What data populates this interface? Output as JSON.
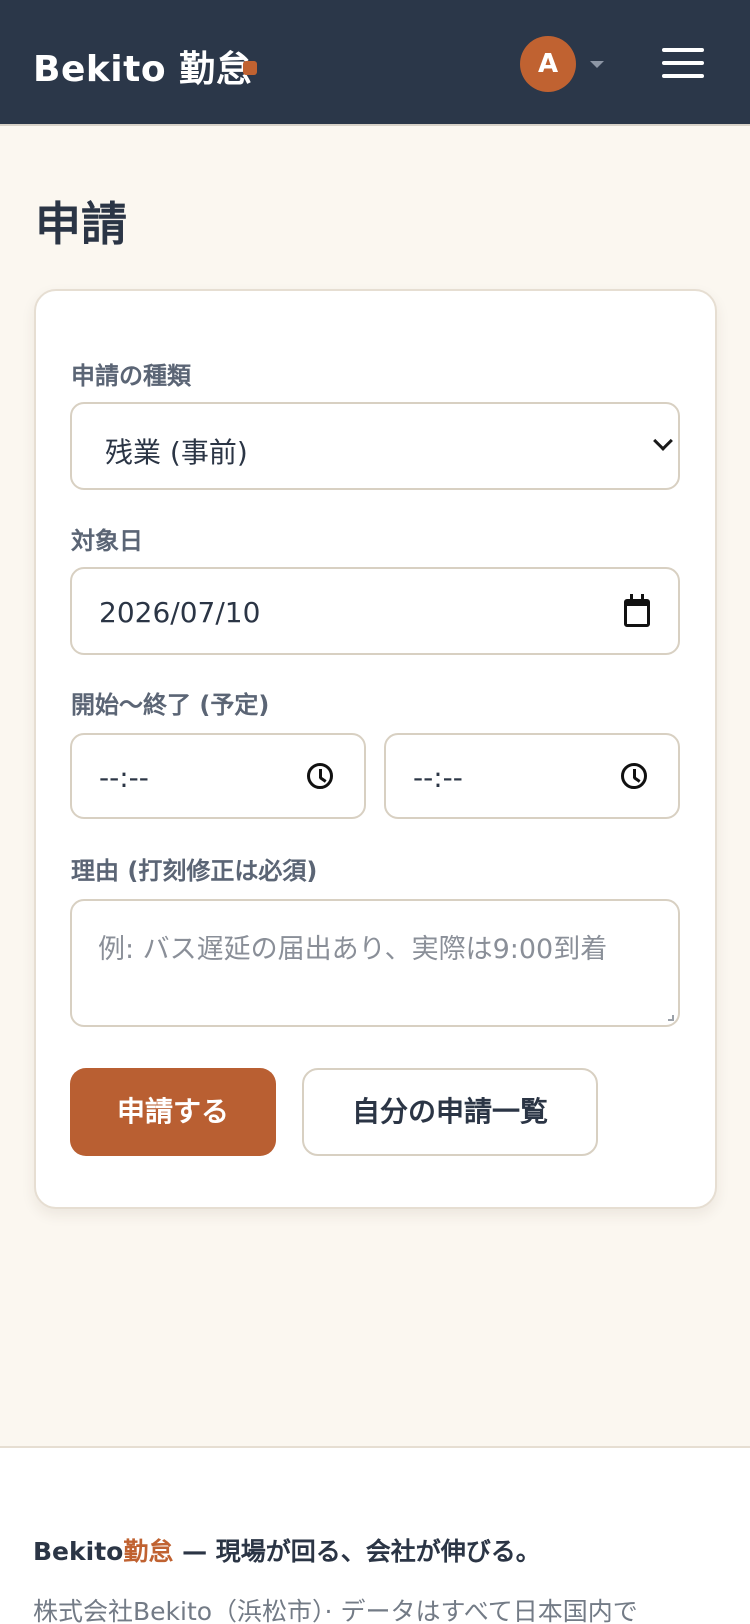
{
  "header": {
    "brand": "Bekito 勤怠",
    "avatar_initial": "A",
    "menu_icon": "hamburger-menu-icon"
  },
  "page": {
    "title": "申請"
  },
  "form": {
    "type_label": "申請の種類",
    "type_value": "残業 (事前)",
    "date_label": "対象日",
    "date_value": "2026/07/10",
    "time_label": "開始〜終了 (予定)",
    "start_time_value": "--:--",
    "end_time_value": "--:--",
    "reason_label": "理由 (打刻修正は必須)",
    "reason_placeholder": "例: バス遅延の届出あり、実際は9:00到着",
    "submit_label": "申請する",
    "my_requests_label": "自分の申請一覧"
  },
  "footer": {
    "tagline_brand_part1": "Bekito",
    "tagline_brand_part2": "勤怠",
    "tagline_rest": " — 現場が回る、会社が伸びる。",
    "note": "株式会社Bekito（浜松市）· データはすべて日本国内で"
  },
  "colors": {
    "header_bg": "#2b3749",
    "accent": "#c06231",
    "page_bg": "#fbf7f0",
    "primary_button": "#b95f32"
  }
}
